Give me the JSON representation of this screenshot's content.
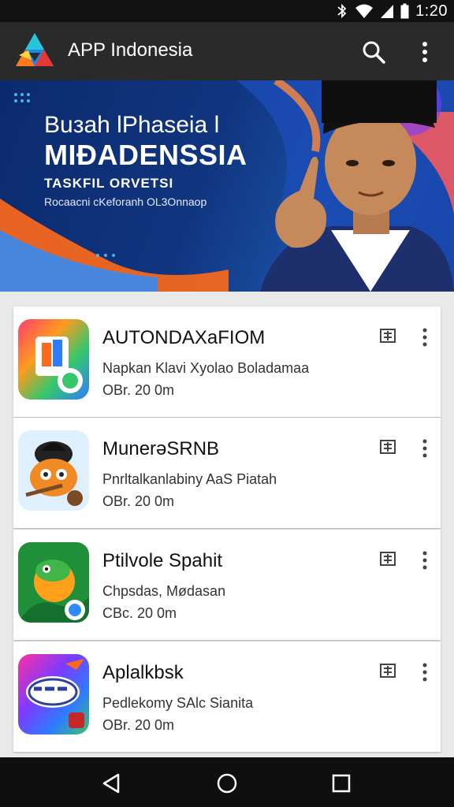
{
  "status_bar": {
    "time": "1:20",
    "icons": [
      "bluetooth-icon",
      "wifi-icon",
      "signal-icon",
      "battery-icon"
    ]
  },
  "app_bar": {
    "title": "APP Indonesia",
    "logo_icon": "triangle-logo-icon",
    "actions": [
      "search-icon",
      "more-vert-icon"
    ]
  },
  "banner": {
    "line1": "Buзah lPhaseia l",
    "line2": "MIÐADENSSIA",
    "line3": "TASKFIL ORVETSI",
    "line4": "Rocaacni cKeforanh OL3Onnaop"
  },
  "apps": [
    {
      "name": "AUTONDAXaFIOM",
      "description": "Napkan Klavi Xyolao Boladamaa",
      "meta": "OBr. 20 0m",
      "icon": "app-icon-document"
    },
    {
      "name": "MunerəSRNB",
      "description": "Pnrltalkanlabiny AaS Piatah",
      "meta": "OBr. 20 0m",
      "icon": "app-icon-mascot"
    },
    {
      "name": "Ptilvole Spahit",
      "description": "Chpsdas, Mødasan",
      "meta": "CBc. 20 0m",
      "icon": "app-icon-frog"
    },
    {
      "name": "Aplalkbsk",
      "description": "Pedlekomy SAlc Sianita",
      "meta": "OBr. 20 0m",
      "icon": "app-icon-app"
    }
  ],
  "colors": {
    "app_bar": "#2a2a2a",
    "status_bar": "#111111",
    "banner_bg": "#10357f",
    "accent_orange": "#ff6a1a",
    "accent_blue": "#2b8cff"
  },
  "nav": [
    "back-icon",
    "home-icon",
    "recents-icon"
  ]
}
